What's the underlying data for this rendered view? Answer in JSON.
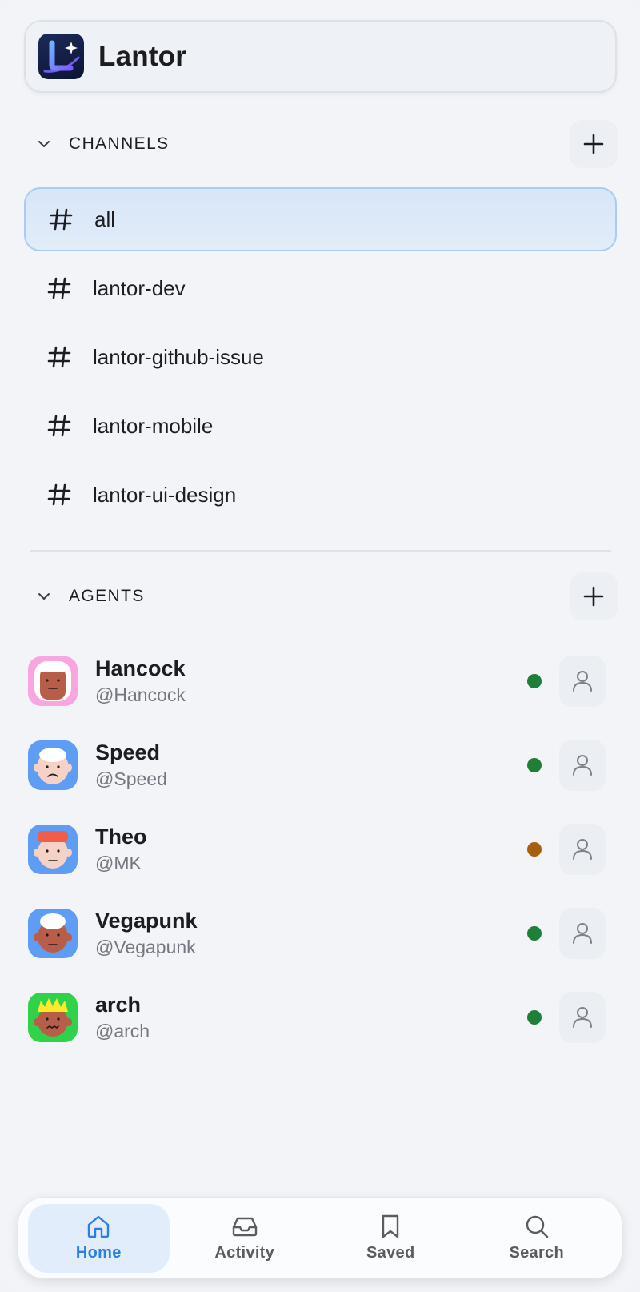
{
  "workspace": {
    "name": "Lantor",
    "logo_icon": "lantor-logo-icon"
  },
  "channels_section": {
    "title": "CHANNELS"
  },
  "channels": [
    {
      "label": "all",
      "active": true
    },
    {
      "label": "lantor-dev",
      "active": false
    },
    {
      "label": "lantor-github-issue",
      "active": false
    },
    {
      "label": "lantor-mobile",
      "active": false
    },
    {
      "label": "lantor-ui-design",
      "active": false
    }
  ],
  "agents_section": {
    "title": "AGENTS"
  },
  "agents": [
    {
      "name": "Hancock",
      "handle": "@Hancock",
      "status": "online",
      "status_color": "#1f7f37",
      "avatar_bg": "#f7a6e0"
    },
    {
      "name": "Speed",
      "handle": "@Speed",
      "status": "online",
      "status_color": "#1f7f37",
      "avatar_bg": "#5f9cf4"
    },
    {
      "name": "Theo",
      "handle": "@MK",
      "status": "away",
      "status_color": "#a85f10",
      "avatar_bg": "#5f9cf4"
    },
    {
      "name": "Vegapunk",
      "handle": "@Vegapunk",
      "status": "online",
      "status_color": "#1f7f37",
      "avatar_bg": "#5f9cf4"
    },
    {
      "name": "arch",
      "handle": "@arch",
      "status": "online",
      "status_color": "#1f7f37",
      "avatar_bg": "#2fd24a"
    }
  ],
  "nav": [
    {
      "label": "Home",
      "icon": "home-icon",
      "active": true
    },
    {
      "label": "Activity",
      "icon": "inbox-icon",
      "active": false
    },
    {
      "label": "Saved",
      "icon": "bookmark-icon",
      "active": false
    },
    {
      "label": "Search",
      "icon": "search-icon",
      "active": false
    }
  ],
  "colors": {
    "accent": "#2c7fe0",
    "online": "#1f7f37",
    "away": "#a85f10"
  }
}
